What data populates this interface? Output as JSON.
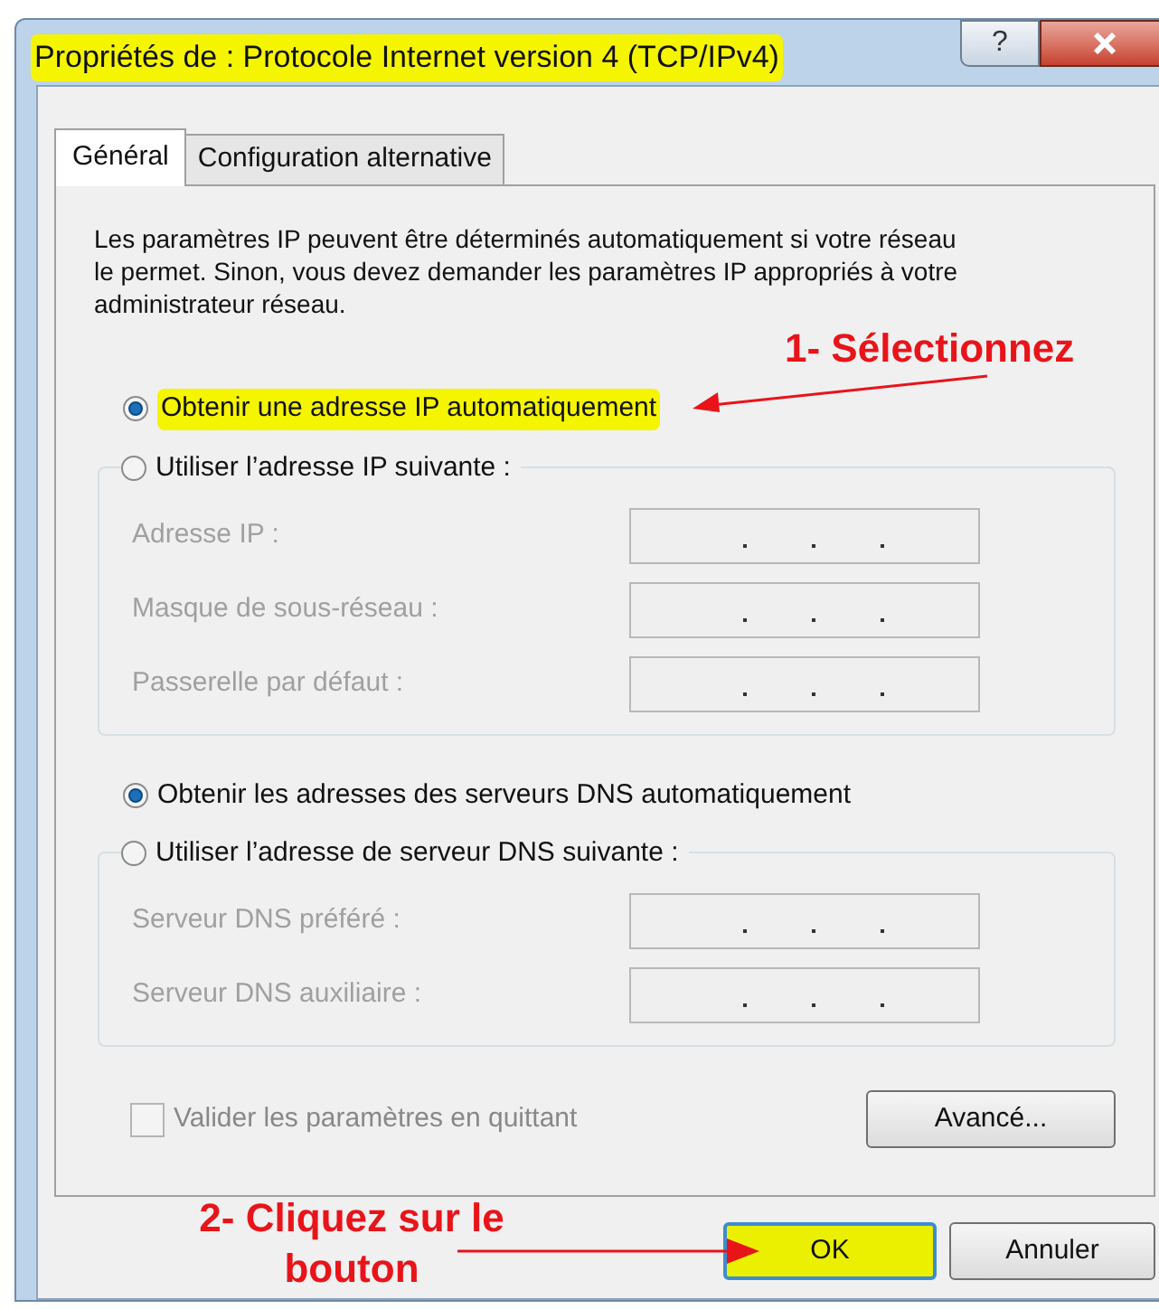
{
  "window": {
    "title": "Propriétés de : Protocole Internet version 4 (TCP/IPv4)",
    "title_highlighted": true,
    "help": "?"
  },
  "tabs": [
    {
      "label": "Général",
      "selected": true
    },
    {
      "label": "Configuration alternative",
      "selected": false
    }
  ],
  "description": "Les paramètres IP peuvent être déterminés automatiquement si votre réseau le permet. Sinon, vous devez demander les paramètres IP appropriés à votre administrateur réseau.",
  "groups": [
    {
      "auto_option": {
        "label": "Obtenir une adresse IP automatiquement",
        "selected": true,
        "highlighted": true
      },
      "manual_option": {
        "label": "Utiliser l’adresse IP suivante :",
        "selected": false
      },
      "fields": [
        {
          "label": "Adresse IP :",
          "disabled": true
        },
        {
          "label": "Masque de sous-réseau :",
          "disabled": true
        },
        {
          "label": "Passerelle par défaut :",
          "disabled": true
        }
      ]
    },
    {
      "auto_option": {
        "label": "Obtenir les adresses des serveurs DNS automatiquement",
        "selected": true,
        "highlighted": false
      },
      "manual_option": {
        "label": "Utiliser l’adresse de serveur DNS suivante :",
        "selected": false
      },
      "fields": [
        {
          "label": "Serveur DNS préféré :",
          "disabled": true
        },
        {
          "label": "Serveur DNS auxiliaire :",
          "disabled": true
        }
      ]
    }
  ],
  "validate_checkbox": {
    "label": "Valider les paramètres en quittant",
    "checked": false,
    "disabled": true
  },
  "advanced_button": "Avancé...",
  "buttons": [
    {
      "label": "OK",
      "highlighted": true
    },
    {
      "label": "Annuler",
      "highlighted": false
    }
  ],
  "annotations": [
    "1- Sélectionnez",
    "2- Cliquez sur le bouton"
  ]
}
